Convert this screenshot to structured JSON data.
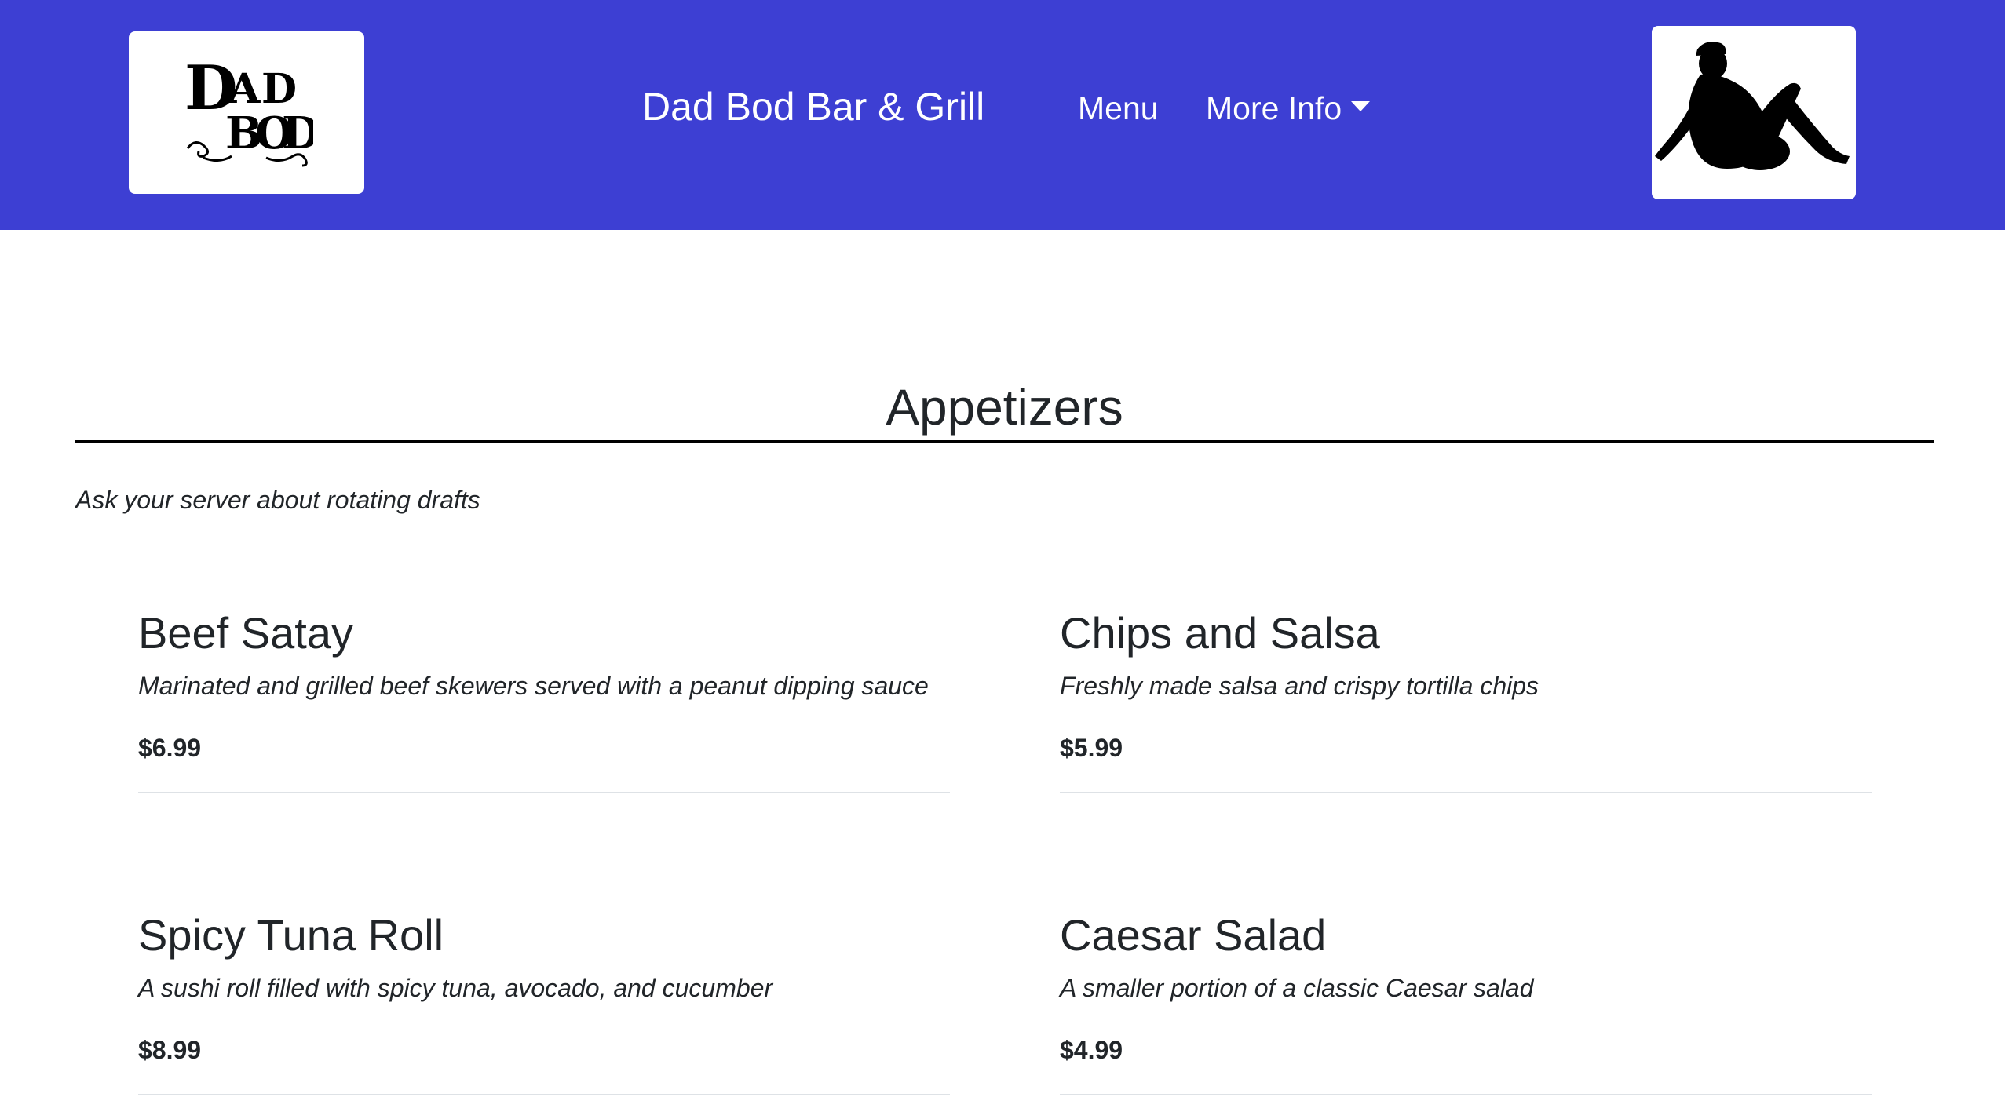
{
  "header": {
    "brand": "Dad Bod Bar & Grill",
    "nav": {
      "menu_label": "Menu",
      "more_info_label": "More Info"
    },
    "logo_text": "DAD BOD",
    "bg_color": "#3d3fd3"
  },
  "section": {
    "title": "Appetizers",
    "note": "Ask your server about rotating drafts"
  },
  "items": [
    {
      "name": "Beef Satay",
      "description": "Marinated and grilled beef skewers served with a peanut dipping sauce",
      "price": "$6.99"
    },
    {
      "name": "Chips and Salsa",
      "description": "Freshly made salsa and crispy tortilla chips",
      "price": "$5.99"
    },
    {
      "name": "Spicy Tuna Roll",
      "description": "A sushi roll filled with spicy tuna, avocado, and cucumber",
      "price": "$8.99"
    },
    {
      "name": "Caesar Salad",
      "description": "A smaller portion of a classic Caesar salad",
      "price": "$4.99"
    }
  ]
}
